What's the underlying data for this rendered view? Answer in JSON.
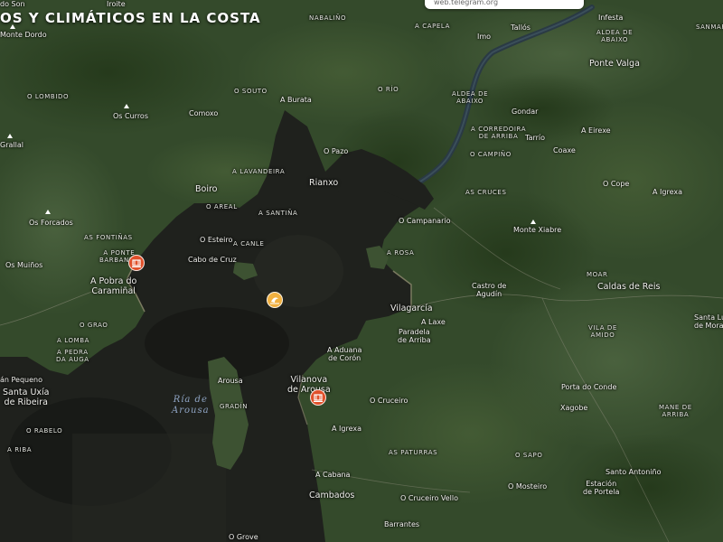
{
  "title": "OS Y CLIMÁTICOS EN LA COSTA",
  "url_bar": "web.telegram.org",
  "sea_label": {
    "line1": "Ría de",
    "line2": "Arousa"
  },
  "colors": {
    "land": "#314629",
    "sea": "#1d1f1b",
    "marker_red": "#e0502a",
    "marker_yellow": "#f0b040"
  },
  "markers": [
    {
      "name": "marker-a-pobra",
      "color": "red",
      "icon": "beach-icon"
    },
    {
      "name": "marker-center-ria",
      "color": "yellow",
      "icon": "wave-icon"
    },
    {
      "name": "marker-vilanova",
      "color": "red",
      "icon": "beach-icon"
    }
  ],
  "places": {
    "iroite": "Iroite",
    "do_son": "do Son",
    "monte_dordo": "Monte Dordo",
    "nabalino": "NABALIÑO",
    "a_capela": "A CAPELA",
    "tallos": "Tallós",
    "imo": "Imo",
    "infesta": "Infesta",
    "aldea_abaixo_top": "ALDEA DE\nABAIXO",
    "sanmartino": "SANMARTI",
    "ponte_valga": "Ponte Valga",
    "o_lombido": "O LOMBIDO",
    "o_souto": "O SOUTO",
    "o_rio": "O RÍO",
    "a_burata": "A Burata",
    "aldea_abaixo_mid": "ALDEA DE\nABAIXO",
    "os_curros": "Os Curros",
    "comoxo": "Comoxo",
    "gondar": "Gondar",
    "a_correidoira": "A CORREDOIRA\nDE ARRIBA",
    "tarrio": "Tarrío",
    "a_eirexe": "A Eirexe",
    "grallal": "Grallal",
    "o_pazo": "O Pazo",
    "coaxe": "Coaxe",
    "a_lavandeira": "A LAVANDEIRA",
    "o_campino": "O CAMPIÑO",
    "o_cope": "O Cope",
    "boiro": "Boiro",
    "rianxo": "Rianxo",
    "as_cruces": "AS CRUCES",
    "a_igrexa_right": "A Igrexa",
    "o_areal": "O AREAL",
    "a_santina": "A SANTIÑA",
    "os_forcados": "Os Forcados",
    "o_campanario": "O Campanario",
    "monte_xiabre": "Monte Xiabre",
    "as_fontinas": "AS FONTIÑAS",
    "o_esteiro": "O Esteiro",
    "a_canle": "A CANLE",
    "a_ponte_barbanza": "A PONTE\nBARBANZA",
    "a_rosa": "A ROSA",
    "cabo_de_cruz": "Cabo de Cruz",
    "os_muinos": "Os Muiños",
    "moar": "MOAR",
    "a_pobra": "A Pobra do\nCaramiñal",
    "castro_agudin": "Castro de\nAgudín",
    "caldas_de_reis": "Caldas de Reis",
    "vilagarcia": "Vilagarcía",
    "o_grao": "O GRAO",
    "a_laxe": "A Laxe",
    "paradela": "Paradela\nde Arriba",
    "santa_luc": "Santa Lu\nde Mora",
    "vila_amido": "VILA DE\nAMIDO",
    "a_lomba": "A LOMBA",
    "a_pedra_da_auga": "A PEDRA\nDA AUGA",
    "a_aduana": "A Aduana\nde Corón",
    "arousa": "Arousa",
    "an_pequeno": "án Pequeno",
    "vilanova": "Vilanova\nde Arousa",
    "porta_do_conde": "Porta do Conde",
    "o_cruceiro": "O Cruceiro",
    "santa_uxia": "Santa Uxía\nde Ribeira",
    "gradin": "GRADÍN",
    "xagobe": "Xagobe",
    "mane_de_arriba": "MANE DE\nARRIBA",
    "o_rabelo": "O RABELO",
    "a_igrexa_bottom": "A Igrexa",
    "a_riba": "A RIBA",
    "as_paturras": "AS PATURRAS",
    "o_sapo": "O SAPO",
    "santo_antonio": "Santo Antoniño",
    "a_cabana": "A Cabana",
    "o_mosteiro": "O Mosteiro",
    "estacion_portela": "Estación\nde Portela",
    "cambados": "Cambados",
    "o_cruceiro_vello": "O Cruceiro Vello",
    "barrantes": "Barrantes",
    "o_grove": "O Grove"
  }
}
